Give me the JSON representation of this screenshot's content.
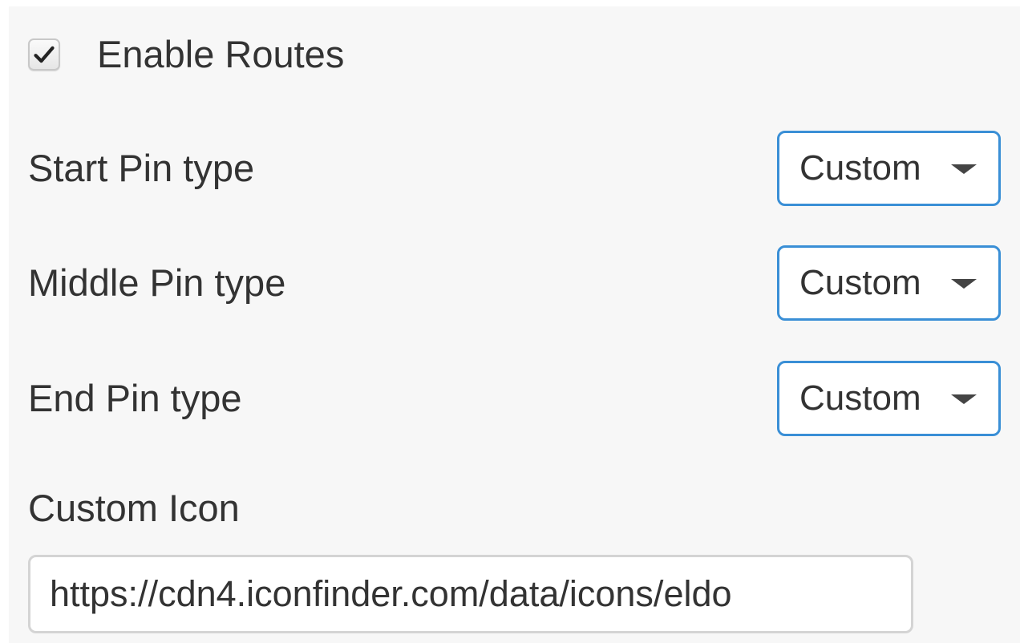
{
  "routes": {
    "enable_label": "Enable Routes",
    "enabled": true
  },
  "pins": [
    {
      "label": "Start Pin type",
      "value": "Custom"
    },
    {
      "label": "Middle Pin type",
      "value": "Custom"
    },
    {
      "label": "End Pin type",
      "value": "Custom"
    }
  ],
  "custom_icon": {
    "label": "Custom Icon",
    "value": "https://cdn4.iconfinder.com/data/icons/eldo"
  },
  "colors": {
    "select_border": "#3a8fd6",
    "panel_background": "#f7f7f7",
    "text": "#333333"
  },
  "icons": {
    "checkbox": "checkmark-icon",
    "dropdown": "caret-down-icon"
  }
}
